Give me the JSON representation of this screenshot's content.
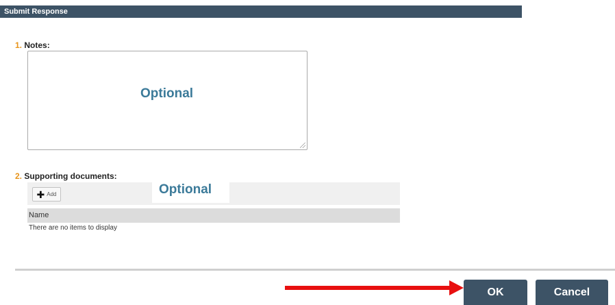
{
  "dialog": {
    "title": "Submit Response"
  },
  "questions": [
    {
      "number": "1.",
      "label": "Notes:"
    },
    {
      "number": "2.",
      "label": "Supporting documents:"
    }
  ],
  "notes": {
    "hint": "Optional"
  },
  "documents": {
    "hint": "Optional",
    "add_label": "Add",
    "column_name": "Name",
    "empty_text": "There are no items to display"
  },
  "footer": {
    "ok_label": "OK",
    "cancel_label": "Cancel"
  },
  "colors": {
    "header": "#3d5366",
    "accent_number": "#e8941a",
    "hint": "#3b7a99",
    "arrow": "#e81010"
  },
  "icons": {
    "add": "plus-icon",
    "pointer": "arrow-right-icon"
  }
}
